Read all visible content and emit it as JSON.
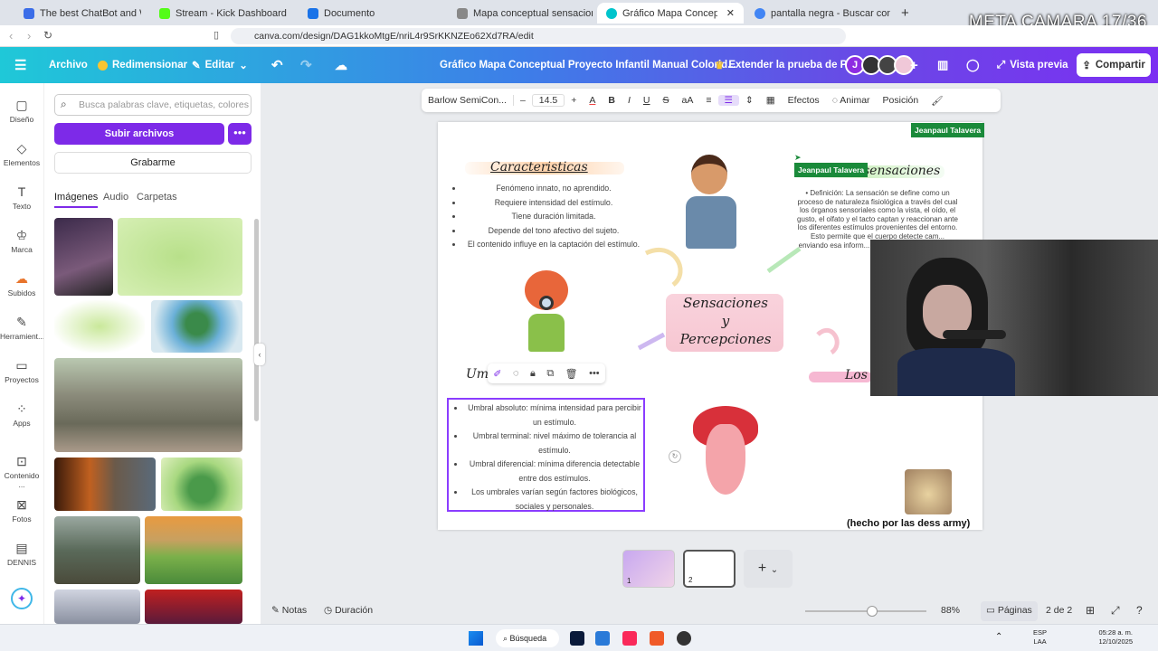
{
  "browser": {
    "tabs": [
      {
        "label": "The best ChatBot and Widgets fo",
        "color": "#3b6de8"
      },
      {
        "label": "Stream - Kick Dashboard",
        "color": "#53fc18"
      },
      {
        "label": "Documento",
        "color": "#1a73e8"
      },
      {
        "label": "Mapa conceptual sensaciones",
        "color": "#888888"
      },
      {
        "label": "Gráfico Mapa Conceptual Proye",
        "color": "#00c4cc"
      },
      {
        "label": "pantalla negra - Buscar con Google",
        "color": "#4285f4"
      }
    ],
    "new_tab": "+",
    "url": "canva.com/design/DAG1kkoMtgE/nriL4r9SrKKNZEo62Xd7RA/edit"
  },
  "overlay": {
    "label": "META CAMARA 17/36"
  },
  "header": {
    "archivo": "Archivo",
    "resize": "Redimensionar",
    "edit": "Editar",
    "title": "Gráfico Mapa Conceptual Proyecto Infantil Manual Colorid...",
    "trial": "Extender la prueba de Pro",
    "avatar_initial": "J",
    "preview": "Vista previa",
    "share": "Compartir"
  },
  "rail": [
    {
      "label": "Diseño",
      "icon": "design-icon"
    },
    {
      "label": "Elementos",
      "icon": "elements-icon"
    },
    {
      "label": "Texto",
      "icon": "text-icon"
    },
    {
      "label": "Marca",
      "icon": "brand-icon"
    },
    {
      "label": "Subidos",
      "icon": "upload-icon"
    },
    {
      "label": "Herramient...",
      "icon": "tools-icon"
    },
    {
      "label": "Proyectos",
      "icon": "folder-icon"
    },
    {
      "label": "Apps",
      "icon": "apps-icon"
    },
    {
      "label": "Contenido ...",
      "icon": "content-icon"
    },
    {
      "label": "Fotos",
      "icon": "photo-icon"
    },
    {
      "label": "DENNIS",
      "icon": "dennis-icon"
    }
  ],
  "panel": {
    "search_placeholder": "Busca palabras clave, etiquetas, colores",
    "upload": "Subir archivos",
    "more": "•••",
    "record": "Grabarme",
    "tabs": [
      "Imágenes",
      "Audio",
      "Carpetas"
    ]
  },
  "toolbar": {
    "font": "Barlow SemiCon...",
    "minus": "–",
    "size": "14.5",
    "plus": "+",
    "effects": "Efectos",
    "animate": "Animar",
    "position": "Posición"
  },
  "canvas": {
    "name_tag": "Jeanpaul Talavera",
    "caracteristicas_title": "Caracteristicas",
    "caracteristicas": [
      "Fenómeno innato, no aprendido.",
      "Requiere intensidad del estímulo.",
      "Tiene duración limitada.",
      "Depende del tono afectivo del sujeto.",
      "El contenido influye en la captación del estímulo."
    ],
    "sensaciones_title": "sensaciones",
    "sensaciones_def": "Definición: La sensación se define como un proceso de naturaleza fisiológica a través del cual los órganos sensoriales como la vista, el oído, el gusto, el olfato y el tacto captan y reaccionan ante los diferentes estímulos provenientes del entorno. Esto permite que el cuerpo detecte cam... enviando esa inform... posterior interpret... Feld...",
    "center_title": [
      "Sensaciones",
      "y",
      "Percepciones"
    ],
    "umbrales_title": "Um...les",
    "umbrales": [
      "Umbral absoluto: mínima intensidad para percibir un estímulo.",
      "Umbral terminal: nivel máximo de tolerancia al estímulo.",
      "Umbral diferencial: mínima diferencia detectable entre dos estímulos.",
      "Los umbrales varían según factores biológicos, sociales y personales."
    ],
    "los_label": "Los",
    "credit": "(hecho por las dess army)"
  },
  "pages": {
    "p1": "1",
    "p2": "2",
    "add": "+"
  },
  "footer": {
    "notes": "Notas",
    "duration": "Duración",
    "zoom": "88%",
    "pages_btn": "Páginas",
    "page_count": "2 de 2"
  },
  "taskbar": {
    "search": "Búsqueda",
    "lang1": "ESP",
    "lang2": "LAA",
    "time": "05:28 a. m.",
    "date": "12/10/2025"
  }
}
